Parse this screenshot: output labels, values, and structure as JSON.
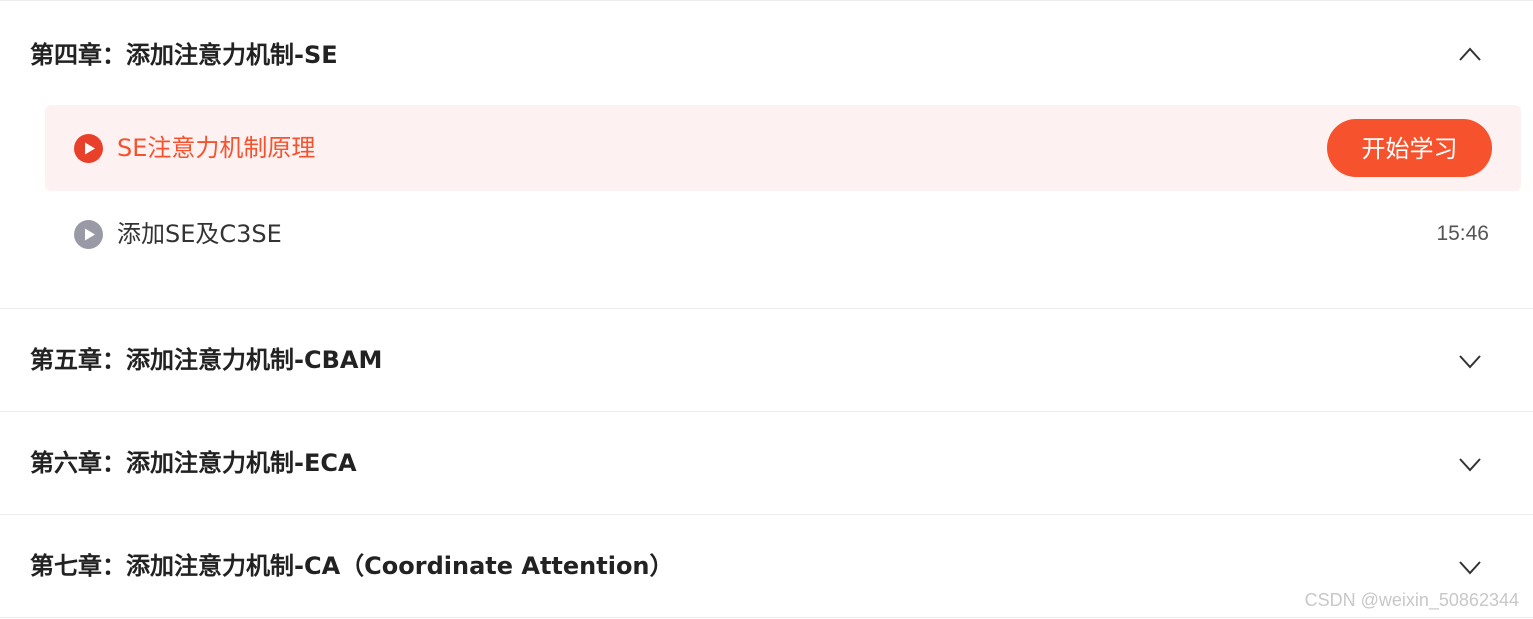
{
  "chapters": [
    {
      "title": "第四章：添加注意力机制-SE",
      "expanded": true,
      "chevron_icon": "chevron-up-icon",
      "lessons": [
        {
          "title": "SE注意力机制原理",
          "active": true,
          "action_label": "开始学习"
        },
        {
          "title": "添加SE及C3SE",
          "active": false,
          "duration": "15:46"
        }
      ]
    },
    {
      "title": "第五章：添加注意力机制-CBAM",
      "expanded": false,
      "chevron_icon": "chevron-down-icon"
    },
    {
      "title": "第六章：添加注意力机制-ECA",
      "expanded": false,
      "chevron_icon": "chevron-down-icon"
    },
    {
      "title": "第七章：添加注意力机制-CA（Coordinate Attention）",
      "expanded": false,
      "chevron_icon": "chevron-down-icon"
    }
  ],
  "watermark": "CSDN @weixin_50862344",
  "colors": {
    "accent": "#f5522d",
    "active_row_bg": "#fdf2f1",
    "inactive_icon": "#9a9aa6",
    "title_text": "#222222"
  }
}
